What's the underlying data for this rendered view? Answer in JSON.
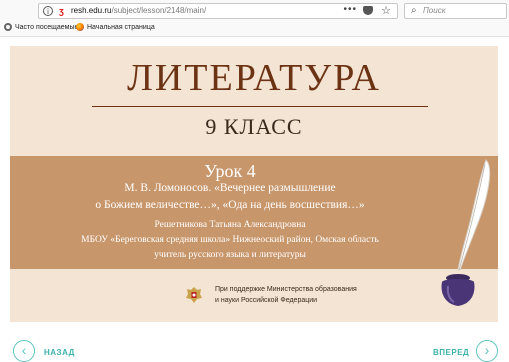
{
  "browser": {
    "url_host": "resh.edu.ru",
    "url_path": "/subject/lesson/2148/main/",
    "more_glyph": "•••",
    "search_placeholder": "Поиск",
    "bookmarks": [
      "Часто посещаемые",
      "Начальная страница"
    ]
  },
  "slide": {
    "title": "ЛИТЕРАТУРА",
    "grade": "9 КЛАСС",
    "lesson": "Урок 4",
    "topic_line1": "М. В. Ломоносов. «Вечернее размышление",
    "topic_line2": "о Божием величестве…», «Ода на день восшествия…»",
    "author": "Решетникова Татьяна  Александровна",
    "school": "МБОУ «Береговская средняя школа» Нижнеоский район, Омская область",
    "role": "учитель русского языка и литературы",
    "support_line1": "При поддержке Министерства образования",
    "support_line2": "и науки Российской Федерации"
  },
  "navigation": {
    "back_label": "НАЗАД",
    "forward_label": "ВПЕРЕД"
  },
  "colors": {
    "slide_bg": "#f3e4d3",
    "title_brown": "#6b3214",
    "band": "#c8966b",
    "nav_teal": "#5cc3bd"
  }
}
